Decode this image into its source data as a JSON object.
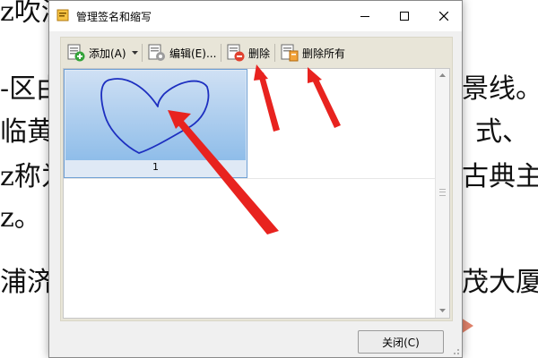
{
  "background_doc": {
    "lines": [
      {
        "left": "z吹济",
        "right": ""
      },
      {
        "left": "-区由",
        "right": "景线。"
      },
      {
        "left": "临黄",
        "right": "式、"
      },
      {
        "left": "z称为",
        "right": "古典主"
      },
      {
        "left": "z。",
        "right": ""
      },
      {
        "left": "浦济",
        "right": "茂大厦"
      }
    ]
  },
  "window": {
    "title": "管理签名和缩写"
  },
  "toolbar": {
    "add_label": "添加(A)",
    "edit_label": "编辑(E)...",
    "delete_label": "删除",
    "delete_all_label": "删除所有"
  },
  "signatures": [
    {
      "label": "1",
      "selected": true
    }
  ],
  "footer": {
    "close_label": "关闭(C)"
  },
  "colors": {
    "annotation_arrow": "#e8231f",
    "signature_stroke": "#1d2fc0",
    "selection_border": "#6d9fd4"
  }
}
